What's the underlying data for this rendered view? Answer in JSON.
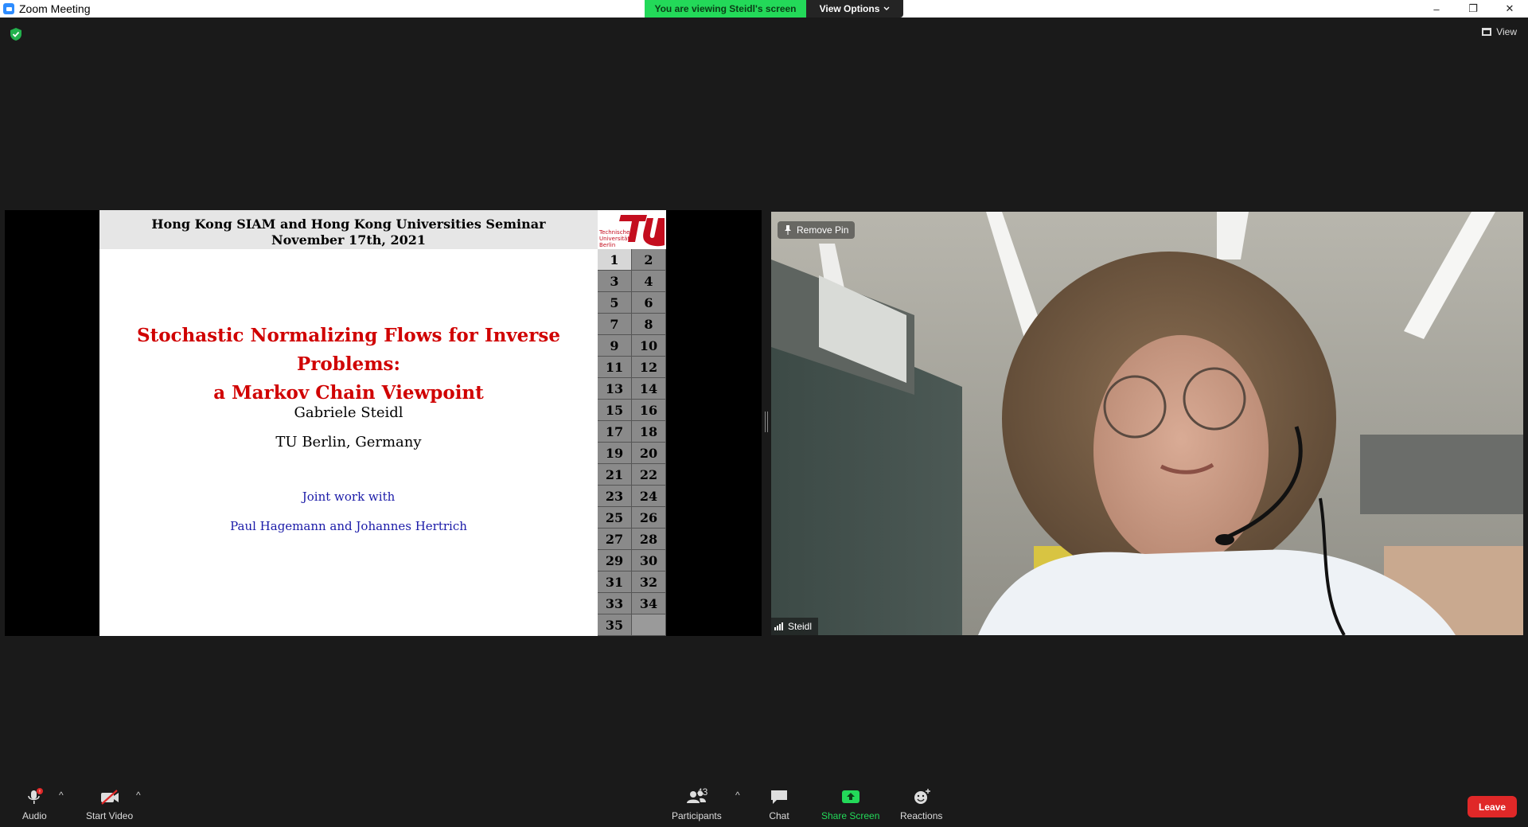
{
  "window": {
    "title": "Zoom Meeting",
    "share_banner": "You are viewing Steidl's screen",
    "view_options": "View Options",
    "controls": [
      "–",
      "❐",
      "✕"
    ]
  },
  "top": {
    "view_label": "View"
  },
  "slide": {
    "header_line1": "Hong Kong SIAM and Hong Kong Universities Seminar",
    "header_line2": "November 17th, 2021",
    "title_line1": "Stochastic Normalizing Flows for Inverse Problems:",
    "title_line2": "a Markov Chain Viewpoint",
    "author": "Gabriele Steidl",
    "affiliation": "TU Berlin, Germany",
    "joint": "Joint work with",
    "coauthors": "Paul Hagemann and Johannes Hertrich",
    "logo_text": "Technische Universität Berlin",
    "logo_side": "berlin",
    "nav_pages": [
      "1",
      "2",
      "3",
      "4",
      "5",
      "6",
      "7",
      "8",
      "9",
      "10",
      "11",
      "12",
      "13",
      "14",
      "15",
      "16",
      "17",
      "18",
      "19",
      "20",
      "21",
      "22",
      "23",
      "24",
      "25",
      "26",
      "27",
      "28",
      "29",
      "30",
      "31",
      "32",
      "33",
      "34",
      "35",
      ""
    ],
    "current_page": "1"
  },
  "video": {
    "remove_pin": "Remove Pin",
    "participant_name": "Steidl"
  },
  "toolbar": {
    "audio": "Audio",
    "start_video": "Start Video",
    "participants": "Participants",
    "participant_count": "43",
    "chat": "Chat",
    "share_screen": "Share Screen",
    "reactions": "Reactions",
    "leave": "Leave"
  },
  "colors": {
    "share_green": "#23d959",
    "slide_title_red": "#d00000",
    "slide_link_blue": "#1a1aa8",
    "leave_red": "#e02828"
  }
}
